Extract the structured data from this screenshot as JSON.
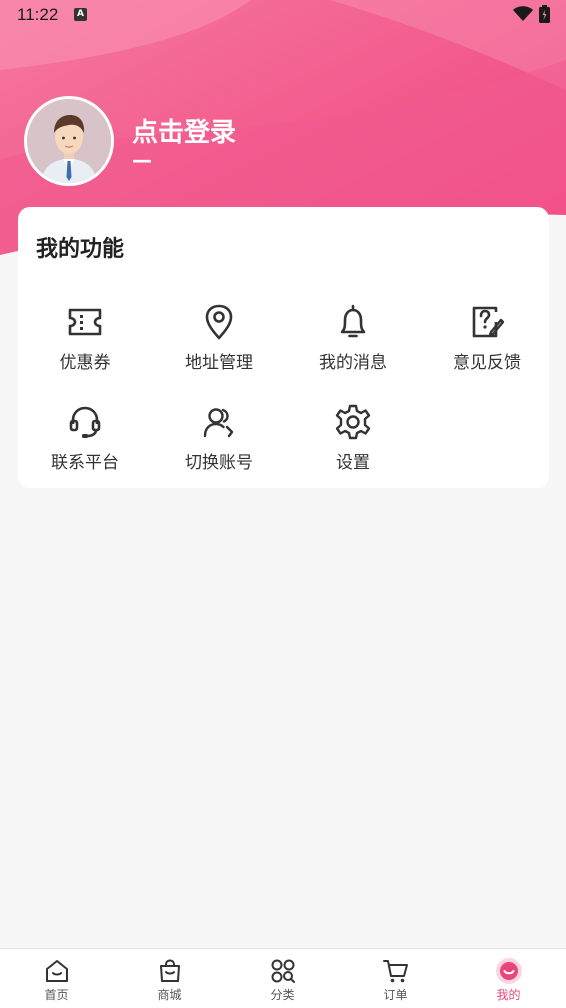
{
  "status_bar": {
    "time": "11:22",
    "notification_icon": "A"
  },
  "profile": {
    "login_label": "点击登录",
    "subtitle": "—"
  },
  "functions": {
    "title": "我的功能",
    "items": [
      {
        "label": "优惠券",
        "icon": "coupon-icon"
      },
      {
        "label": "地址管理",
        "icon": "location-icon"
      },
      {
        "label": "我的消息",
        "icon": "bell-icon"
      },
      {
        "label": "意见反馈",
        "icon": "feedback-icon"
      },
      {
        "label": "联系平台",
        "icon": "headset-icon"
      },
      {
        "label": "切换账号",
        "icon": "switch-user-icon"
      },
      {
        "label": "设置",
        "icon": "gear-icon"
      }
    ]
  },
  "tabbar": {
    "tabs": [
      {
        "label": "首页",
        "icon": "home-icon"
      },
      {
        "label": "商城",
        "icon": "shop-bag-icon"
      },
      {
        "label": "分类",
        "icon": "category-icon"
      },
      {
        "label": "订单",
        "icon": "cart-icon"
      },
      {
        "label": "我的",
        "icon": "profile-icon",
        "active": true
      }
    ]
  },
  "colors": {
    "accent": "#e8457b",
    "header_pink": "#f25b8e",
    "background": "#f7f7f7"
  }
}
